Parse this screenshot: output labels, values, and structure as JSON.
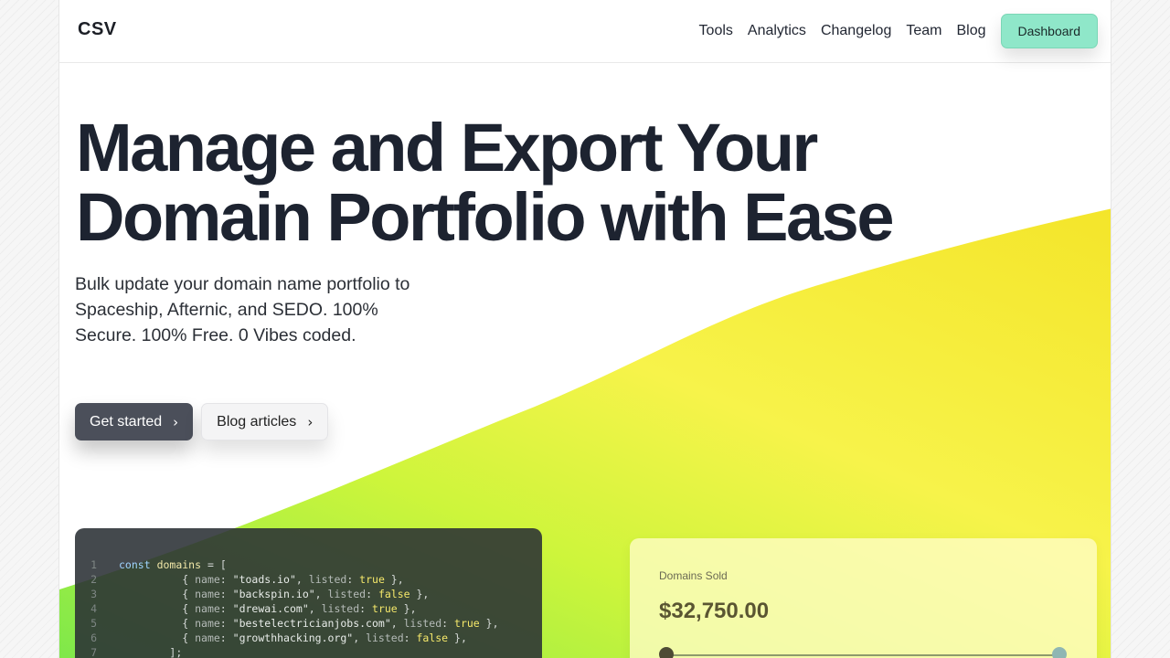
{
  "colors": {
    "accent": "#8fe7c9",
    "primary_button": "#4b4f5a",
    "heading": "#1d2330",
    "wave_yellow": "#f6ec2e",
    "wave_green": "#8ef04a"
  },
  "nav": {
    "logo": "CSV",
    "links": [
      "Tools",
      "Analytics",
      "Changelog",
      "Team",
      "Blog"
    ],
    "cta": "Dashboard"
  },
  "hero": {
    "title_line1": "Manage and Export Your",
    "title_line2": "Domain Portfolio with Ease",
    "subtitle": "Bulk update your domain name portfolio to Spaceship, Afternic, and SEDO. 100% Secure. 100% Free. 0 Vibes coded.",
    "primary_button": "Get started",
    "secondary_button": "Blog articles",
    "chevron_icon": "chevron-right-icon"
  },
  "code": {
    "line_numbers": [
      "1",
      "2",
      "3",
      "4",
      "5",
      "6",
      "7"
    ],
    "keyword": "const",
    "var_name": "domains",
    "open": "= [",
    "close": "];",
    "field_name": "name",
    "field_listed": "listed",
    "rows": [
      {
        "name": "\"toads.io\"",
        "listed": "true"
      },
      {
        "name": "\"backspin.io\"",
        "listed": "false"
      },
      {
        "name": "\"drewai.com\"",
        "listed": "true"
      },
      {
        "name": "\"bestelectricianjobs.com\"",
        "listed": "true"
      },
      {
        "name": "\"growthhacking.org\"",
        "listed": "false"
      }
    ]
  },
  "stats": {
    "label": "Domains Sold",
    "value": "$32,750.00"
  }
}
